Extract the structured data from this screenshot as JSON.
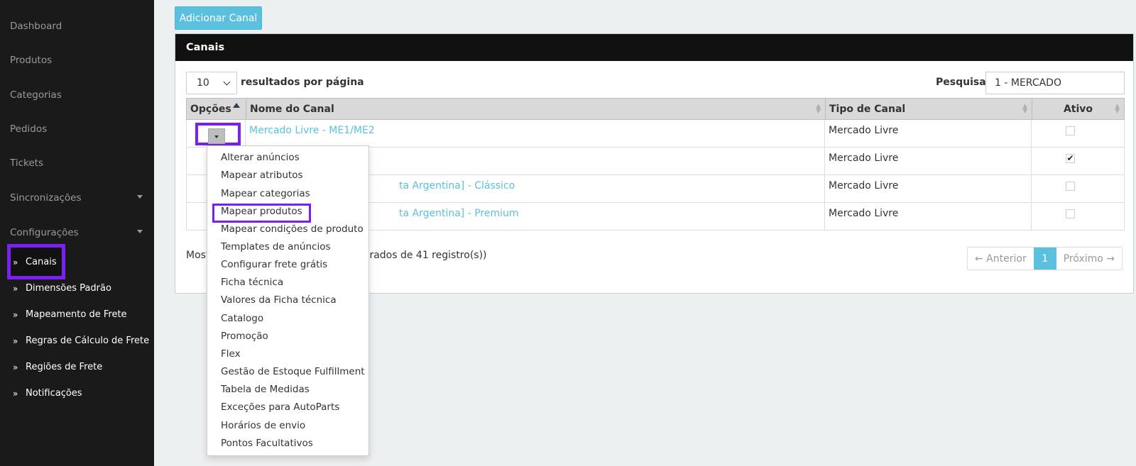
{
  "sidebar": {
    "items": [
      {
        "label": "Dashboard",
        "has_caret": false
      },
      {
        "label": "Produtos",
        "has_caret": false
      },
      {
        "label": "Categorias",
        "has_caret": false
      },
      {
        "label": "Pedidos",
        "has_caret": false
      },
      {
        "label": "Tickets",
        "has_caret": false
      },
      {
        "label": "Sincronizações",
        "has_caret": true
      },
      {
        "label": "Configurações",
        "has_caret": true
      }
    ],
    "sub_items": [
      {
        "label": "Canais",
        "active": true
      },
      {
        "label": "Dimensões Padrão",
        "active": false
      },
      {
        "label": "Mapeamento de Frete",
        "active": false
      },
      {
        "label": "Regras de Cálculo de Frete",
        "active": false
      },
      {
        "label": "Regiões de Frete",
        "active": false
      },
      {
        "label": "Notificações",
        "active": false
      }
    ],
    "sub_icon": "double-chevron-right-icon"
  },
  "toolbar": {
    "add_label": "Adicionar Canal"
  },
  "panel": {
    "title": "Canais",
    "length_value": "10",
    "length_label": "resultados por página",
    "search_label": "Pesquisar",
    "search_value": "1 - MERCADO"
  },
  "table": {
    "headers": [
      "Opções",
      "Nome do Canal",
      "Tipo de Canal",
      "Ativo"
    ],
    "rows": [
      {
        "name": "Mercado Livre - ME1/ME2",
        "type": "Mercado Livre",
        "active": false
      },
      {
        "name": "",
        "type": "Mercado Livre",
        "active": true
      },
      {
        "name": "ta Argentina] - Clássico",
        "type": "Mercado Livre",
        "active": false
      },
      {
        "name": "ta Argentina] - Premium",
        "type": "Mercado Livre",
        "active": false
      }
    ]
  },
  "footer": {
    "info_start": "Most",
    "info_end": "rados de 41 registro(s))",
    "prev": "← Anterior",
    "page": "1",
    "next": "Próximo →"
  },
  "dropdown": {
    "items": [
      "Alterar anúncios",
      "Mapear atributos",
      "Mapear categorias",
      "Mapear produtos",
      "Mapear condições de produto",
      "Templates de anúncios",
      "Configurar frete grátis",
      "Ficha técnica",
      "Valores da Ficha técnica",
      "Catalogo",
      "Promoção",
      "Flex",
      "Gestão de Estoque Fulfillment",
      "Tabela de Medidas",
      "Exceções para AutoParts",
      "Horários de envio",
      "Pontos Facultativos"
    ],
    "highlighted": "Mapear produtos"
  },
  "colors": {
    "accent": "#5bc0de",
    "highlight": "#7b1ff2",
    "sidebar_bg": "#1a1a1a",
    "header_bg": "#111111"
  }
}
